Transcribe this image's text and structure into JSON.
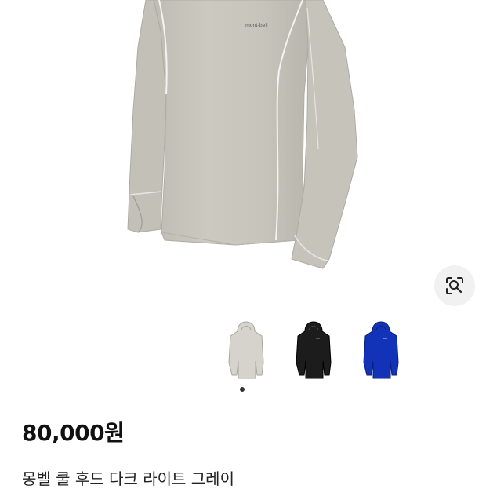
{
  "product": {
    "brand_mark": "mont-bell",
    "price": "80,000원",
    "title": "몽벨 쿨 후드 다크 라이트 그레이"
  },
  "image_lens": {
    "icon": "lens-icon"
  },
  "color_variants": [
    {
      "name": "light-gray",
      "color": "#d5d3cc"
    },
    {
      "name": "black",
      "color": "#1c1c1c"
    },
    {
      "name": "blue",
      "color": "#1232b8"
    }
  ],
  "carousel": {
    "active_index": 0,
    "count": 1
  }
}
